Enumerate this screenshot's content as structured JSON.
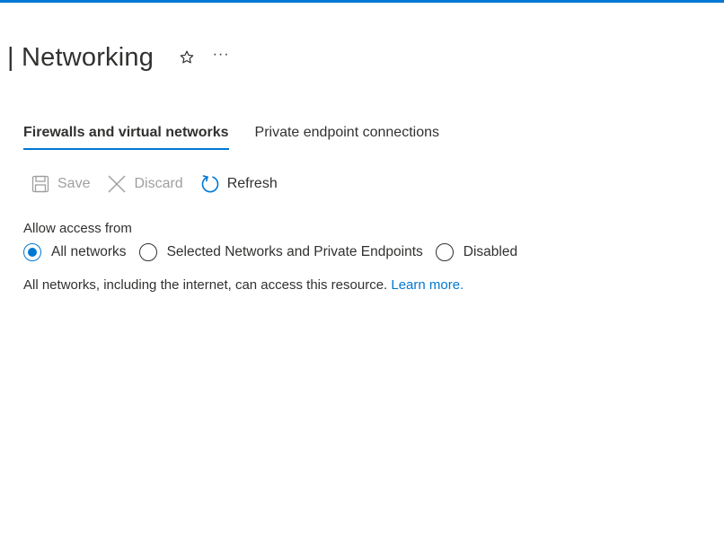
{
  "header": {
    "title": "| Networking",
    "more_label": "···"
  },
  "tabs": [
    {
      "label": "Firewalls and virtual networks",
      "active": true
    },
    {
      "label": "Private endpoint connections",
      "active": false
    }
  ],
  "toolbar": {
    "save_label": "Save",
    "discard_label": "Discard",
    "refresh_label": "Refresh"
  },
  "access": {
    "label": "Allow access from",
    "options": [
      {
        "label": "All networks",
        "checked": true
      },
      {
        "label": "Selected Networks and Private Endpoints",
        "checked": false
      },
      {
        "label": "Disabled",
        "checked": false
      }
    ]
  },
  "info": {
    "text": "All networks, including the internet, can access this resource.",
    "link_label": "Learn more."
  },
  "colors": {
    "accent": "#0078d4",
    "text": "#323130",
    "disabled": "#a19f9d"
  },
  "icons": {
    "favorite": "star-outline-icon",
    "more": "ellipsis-icon",
    "save": "save-icon",
    "discard": "close-icon",
    "refresh": "refresh-icon"
  }
}
